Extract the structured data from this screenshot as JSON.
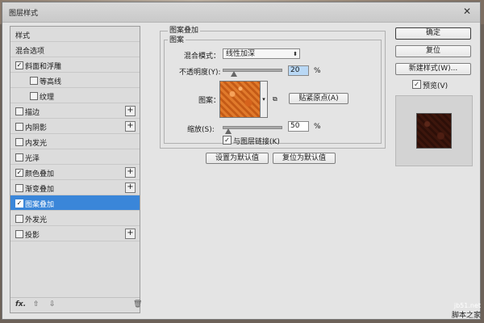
{
  "window": {
    "title": "图层样式",
    "close_glyph": "✕"
  },
  "sidebar": {
    "header": "样式",
    "items": [
      {
        "label": "混合选项",
        "checkbox": false,
        "checked": false,
        "plus": false
      },
      {
        "label": "斜面和浮雕",
        "checkbox": true,
        "checked": true,
        "plus": false
      },
      {
        "label": "等高线",
        "checkbox": true,
        "checked": false,
        "plus": false,
        "sub": true
      },
      {
        "label": "纹理",
        "checkbox": true,
        "checked": false,
        "plus": false,
        "sub": true
      },
      {
        "label": "描边",
        "checkbox": true,
        "checked": false,
        "plus": true
      },
      {
        "label": "内阴影",
        "checkbox": true,
        "checked": false,
        "plus": true
      },
      {
        "label": "内发光",
        "checkbox": true,
        "checked": false,
        "plus": false
      },
      {
        "label": "光泽",
        "checkbox": true,
        "checked": false,
        "plus": false
      },
      {
        "label": "颜色叠加",
        "checkbox": true,
        "checked": true,
        "plus": true
      },
      {
        "label": "渐变叠加",
        "checkbox": true,
        "checked": false,
        "plus": true
      },
      {
        "label": "图案叠加",
        "checkbox": true,
        "checked": true,
        "plus": false,
        "selected": true
      },
      {
        "label": "外发光",
        "checkbox": true,
        "checked": false,
        "plus": false
      },
      {
        "label": "投影",
        "checkbox": true,
        "checked": false,
        "plus": true
      }
    ],
    "footer": {
      "fx": "fx.",
      "up": "⇧",
      "down": "⇩",
      "trash": "🗑"
    }
  },
  "panel": {
    "group_title": "图案叠加",
    "sub_title": "图案",
    "blend_mode_label": "混合模式：",
    "blend_mode_value": "线性加深",
    "opacity_label": "不透明度(Y):",
    "opacity_value": "20",
    "opacity_unit": "%",
    "opacity_fraction": 0.2,
    "pattern_label": "图案：",
    "snap_origin_button": "贴紧原点(A)",
    "scale_label": "缩放(S):",
    "scale_value": "50",
    "scale_unit": "%",
    "scale_fraction": 0.1,
    "link_label": "与图层链接(K)",
    "link_checked": true,
    "set_default_button": "设置为默认值",
    "reset_default_button": "复位为默认值"
  },
  "actions": {
    "ok": "确定",
    "reset": "复位",
    "new_style": "新建样式(W)...",
    "preview_label": "预览(V)",
    "preview_checked": true
  },
  "watermark": {
    "brand": "脚本之家",
    "site": "jb51.net"
  },
  "colors": {
    "selection": "#3a86d9",
    "pattern_main": "#e07a2c",
    "preview_swatch": "#3d160c"
  }
}
